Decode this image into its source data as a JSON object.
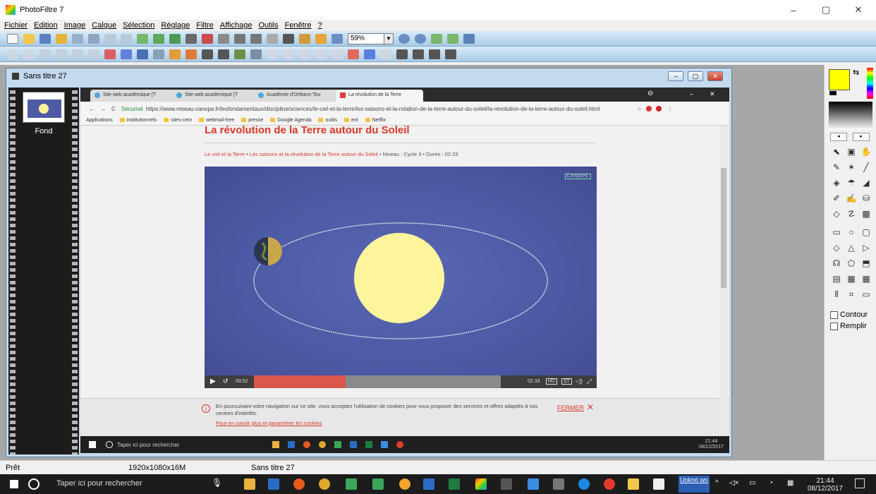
{
  "app": {
    "title": "PhotoFiltre 7"
  },
  "window_controls": {
    "minimize": "–",
    "maximize": "▢",
    "close": "✕"
  },
  "menu": [
    "Fichier",
    "Edition",
    "Image",
    "Calque",
    "Sélection",
    "Réglage",
    "Filtre",
    "Affichage",
    "Outils",
    "Fenêtre",
    "?"
  ],
  "toolbar": {
    "zoom_value": "59%"
  },
  "document": {
    "title": "Sans titre 27",
    "layer_label": "Fond"
  },
  "browser": {
    "tabs": [
      "Site web académique [T",
      "Site web académique [T",
      "Académie d'Orléans-Tou",
      "La révolution de la Terre"
    ],
    "url_secure": "Sécurisé",
    "url": "https://www.reseau-canope.fr/lesfondamentaux/discipline/sciences/le-ciel-et-la-terre/les-saisons-et-la-rotation-de-la-terre-autour-du-soleil/la-revolution-de-la-terre-autour-du-soleil.html",
    "bookmarks": [
      "Applications",
      "institutionnels",
      "sites-cem",
      "webmail-free",
      "presse",
      "Google Agenda",
      "outils",
      "ent",
      "Netflix"
    ]
  },
  "page": {
    "title": "La révolution de la Terre autour du Soleil",
    "breadcrumb_link1": "Le ciel et la Terre",
    "breadcrumb_link2": "Les saisons et la révolution de la Terre autour du Soleil",
    "breadcrumb_meta": "• Niveau : Cycle 3  • Durée : 02:33",
    "video_brand": "CANOPÉ",
    "video_time_left": "00:52",
    "video_time_right": "02:33",
    "video_progress": 0.37,
    "cookie_text": "En poursuivant votre navigation sur ce site, vous acceptez l'utilisation de cookies pour vous proposer des services et offres adaptés à vos centres d'intérêts.",
    "cookie_link": "Pour en savoir plus et paramétrer les cookies",
    "cookie_close": "FERMER"
  },
  "inner_taskbar": {
    "search": "Taper ici pour rechercher",
    "time": "21:44",
    "date": "08/12/2017"
  },
  "right_panel": {
    "contour_label": "Contour",
    "remplir_label": "Remplir"
  },
  "status": {
    "ready": "Prêt",
    "dimensions": "1920x1080x16M",
    "doc_name": "Sans titre 27"
  },
  "taskbar": {
    "search": "Taper ici pour rechercher",
    "unknown_label": "Unkno wn",
    "time": "21:44",
    "date": "08/12/2017"
  },
  "colors": {
    "foreground": "#ffff00",
    "accent_red": "#d9382b",
    "video_bg": "#4a56a0",
    "sun": "#fff59d"
  }
}
